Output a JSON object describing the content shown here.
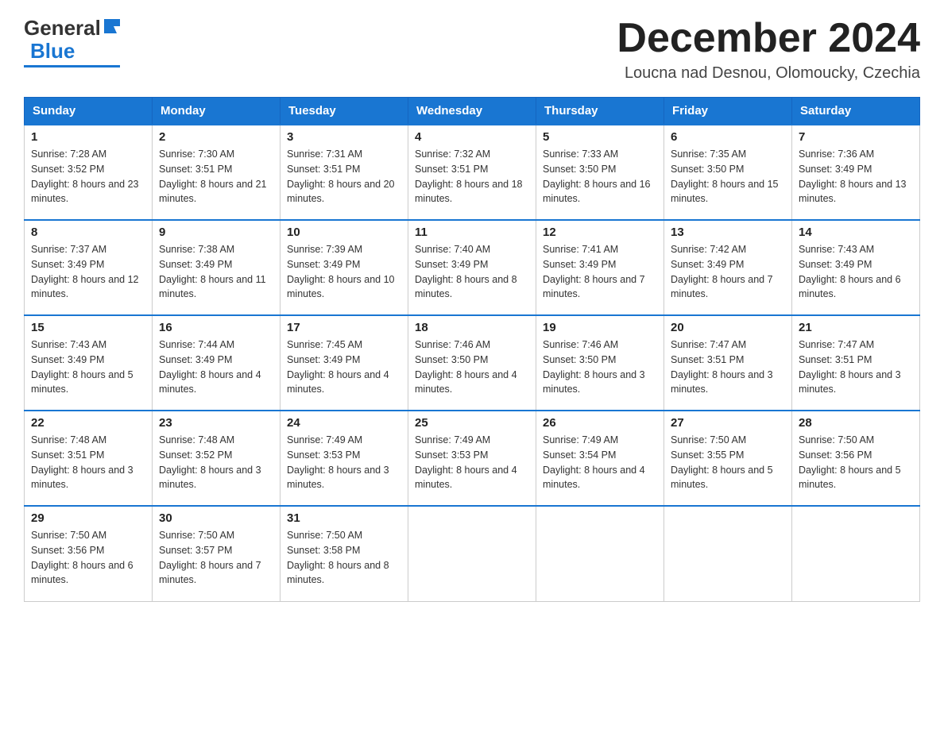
{
  "header": {
    "logo_general": "General",
    "logo_blue": "Blue",
    "month_title": "December 2024",
    "location": "Loucna nad Desnou, Olomoucky, Czechia"
  },
  "weekdays": [
    "Sunday",
    "Monday",
    "Tuesday",
    "Wednesday",
    "Thursday",
    "Friday",
    "Saturday"
  ],
  "weeks": [
    [
      {
        "day": "1",
        "sunrise": "7:28 AM",
        "sunset": "3:52 PM",
        "daylight": "8 hours and 23 minutes."
      },
      {
        "day": "2",
        "sunrise": "7:30 AM",
        "sunset": "3:51 PM",
        "daylight": "8 hours and 21 minutes."
      },
      {
        "day": "3",
        "sunrise": "7:31 AM",
        "sunset": "3:51 PM",
        "daylight": "8 hours and 20 minutes."
      },
      {
        "day": "4",
        "sunrise": "7:32 AM",
        "sunset": "3:51 PM",
        "daylight": "8 hours and 18 minutes."
      },
      {
        "day": "5",
        "sunrise": "7:33 AM",
        "sunset": "3:50 PM",
        "daylight": "8 hours and 16 minutes."
      },
      {
        "day": "6",
        "sunrise": "7:35 AM",
        "sunset": "3:50 PM",
        "daylight": "8 hours and 15 minutes."
      },
      {
        "day": "7",
        "sunrise": "7:36 AM",
        "sunset": "3:49 PM",
        "daylight": "8 hours and 13 minutes."
      }
    ],
    [
      {
        "day": "8",
        "sunrise": "7:37 AM",
        "sunset": "3:49 PM",
        "daylight": "8 hours and 12 minutes."
      },
      {
        "day": "9",
        "sunrise": "7:38 AM",
        "sunset": "3:49 PM",
        "daylight": "8 hours and 11 minutes."
      },
      {
        "day": "10",
        "sunrise": "7:39 AM",
        "sunset": "3:49 PM",
        "daylight": "8 hours and 10 minutes."
      },
      {
        "day": "11",
        "sunrise": "7:40 AM",
        "sunset": "3:49 PM",
        "daylight": "8 hours and 8 minutes."
      },
      {
        "day": "12",
        "sunrise": "7:41 AM",
        "sunset": "3:49 PM",
        "daylight": "8 hours and 7 minutes."
      },
      {
        "day": "13",
        "sunrise": "7:42 AM",
        "sunset": "3:49 PM",
        "daylight": "8 hours and 7 minutes."
      },
      {
        "day": "14",
        "sunrise": "7:43 AM",
        "sunset": "3:49 PM",
        "daylight": "8 hours and 6 minutes."
      }
    ],
    [
      {
        "day": "15",
        "sunrise": "7:43 AM",
        "sunset": "3:49 PM",
        "daylight": "8 hours and 5 minutes."
      },
      {
        "day": "16",
        "sunrise": "7:44 AM",
        "sunset": "3:49 PM",
        "daylight": "8 hours and 4 minutes."
      },
      {
        "day": "17",
        "sunrise": "7:45 AM",
        "sunset": "3:49 PM",
        "daylight": "8 hours and 4 minutes."
      },
      {
        "day": "18",
        "sunrise": "7:46 AM",
        "sunset": "3:50 PM",
        "daylight": "8 hours and 4 minutes."
      },
      {
        "day": "19",
        "sunrise": "7:46 AM",
        "sunset": "3:50 PM",
        "daylight": "8 hours and 3 minutes."
      },
      {
        "day": "20",
        "sunrise": "7:47 AM",
        "sunset": "3:51 PM",
        "daylight": "8 hours and 3 minutes."
      },
      {
        "day": "21",
        "sunrise": "7:47 AM",
        "sunset": "3:51 PM",
        "daylight": "8 hours and 3 minutes."
      }
    ],
    [
      {
        "day": "22",
        "sunrise": "7:48 AM",
        "sunset": "3:51 PM",
        "daylight": "8 hours and 3 minutes."
      },
      {
        "day": "23",
        "sunrise": "7:48 AM",
        "sunset": "3:52 PM",
        "daylight": "8 hours and 3 minutes."
      },
      {
        "day": "24",
        "sunrise": "7:49 AM",
        "sunset": "3:53 PM",
        "daylight": "8 hours and 3 minutes."
      },
      {
        "day": "25",
        "sunrise": "7:49 AM",
        "sunset": "3:53 PM",
        "daylight": "8 hours and 4 minutes."
      },
      {
        "day": "26",
        "sunrise": "7:49 AM",
        "sunset": "3:54 PM",
        "daylight": "8 hours and 4 minutes."
      },
      {
        "day": "27",
        "sunrise": "7:50 AM",
        "sunset": "3:55 PM",
        "daylight": "8 hours and 5 minutes."
      },
      {
        "day": "28",
        "sunrise": "7:50 AM",
        "sunset": "3:56 PM",
        "daylight": "8 hours and 5 minutes."
      }
    ],
    [
      {
        "day": "29",
        "sunrise": "7:50 AM",
        "sunset": "3:56 PM",
        "daylight": "8 hours and 6 minutes."
      },
      {
        "day": "30",
        "sunrise": "7:50 AM",
        "sunset": "3:57 PM",
        "daylight": "8 hours and 7 minutes."
      },
      {
        "day": "31",
        "sunrise": "7:50 AM",
        "sunset": "3:58 PM",
        "daylight": "8 hours and 8 minutes."
      },
      null,
      null,
      null,
      null
    ]
  ]
}
